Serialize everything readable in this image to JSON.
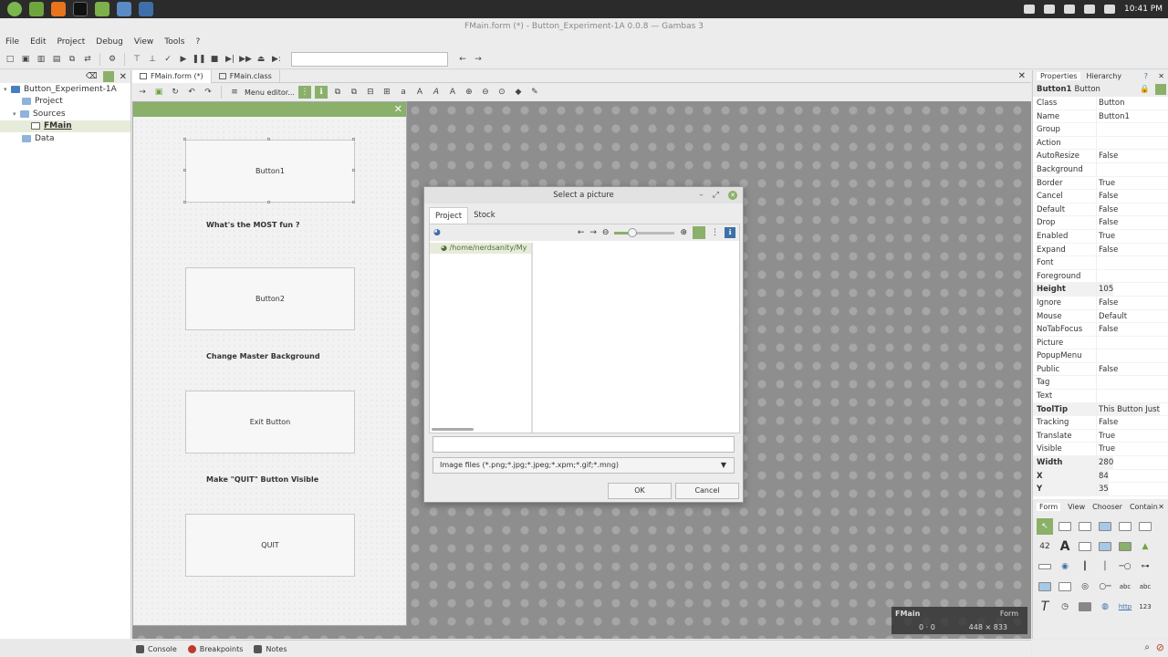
{
  "taskbar": {
    "time": "10:41 PM",
    "icons": [
      "mint-menu-icon",
      "files-icon",
      "firefox-icon",
      "terminal-icon",
      "folder-icon",
      "gambas-icon",
      "screenshot-icon"
    ]
  },
  "window": {
    "title": "FMain.form (*) - Button_Experiment-1A 0.0.8 — Gambas 3"
  },
  "menu": [
    "File",
    "Edit",
    "Project",
    "Debug",
    "View",
    "Tools",
    "?"
  ],
  "project_tree": {
    "root": "Button_Experiment-1A",
    "items": [
      {
        "label": "Project",
        "level": 1
      },
      {
        "label": "Sources",
        "level": 1
      },
      {
        "label": "FMain",
        "level": 2
      },
      {
        "label": "Data",
        "level": 1
      }
    ]
  },
  "editor_tabs": [
    "FMain.form (*)",
    "FMain.class"
  ],
  "editor_toolbar": {
    "menu_editor": "Menu editor..."
  },
  "form": {
    "buttons": [
      {
        "label": "Button1"
      },
      {
        "label": "Button2"
      },
      {
        "label": "Exit Button"
      },
      {
        "label": "QUIT"
      }
    ],
    "labels": [
      "What's the MOST fun ?",
      "Change Master Background",
      "Make \"QUIT\" Button Visible"
    ]
  },
  "dialog": {
    "title": "Select a picture",
    "tabs": [
      "Project",
      "Stock"
    ],
    "dir_path": "/home/nerdsanity/My",
    "zoom_fraction": 0.3,
    "filter": "Image files (*.png;*.jpg;*.jpeg;*.xpm;*.gif;*.mng)",
    "ok_label": "OK",
    "cancel_label": "Cancel"
  },
  "info_box": {
    "name": "FMain",
    "type": "Form",
    "pos": "0 · 0",
    "size": "448 × 833"
  },
  "properties": {
    "tabs": [
      "Properties",
      "Hierarchy"
    ],
    "title_name": "Button1",
    "title_type": "Button",
    "rows": [
      {
        "name": "Class",
        "value": "Button",
        "bold": false
      },
      {
        "name": "Name",
        "value": "Button1",
        "bold": false
      },
      {
        "name": "Group",
        "value": "",
        "bold": false
      },
      {
        "name": "Action",
        "value": "",
        "bold": false
      },
      {
        "name": "AutoResize",
        "value": "False",
        "bold": false
      },
      {
        "name": "Background",
        "value": "",
        "bold": false
      },
      {
        "name": "Border",
        "value": "True",
        "bold": false
      },
      {
        "name": "Cancel",
        "value": "False",
        "bold": false
      },
      {
        "name": "Default",
        "value": "False",
        "bold": false
      },
      {
        "name": "Drop",
        "value": "False",
        "bold": false
      },
      {
        "name": "Enabled",
        "value": "True",
        "bold": false
      },
      {
        "name": "Expand",
        "value": "False",
        "bold": false
      },
      {
        "name": "Font",
        "value": "",
        "bold": false
      },
      {
        "name": "Foreground",
        "value": "",
        "bold": false
      },
      {
        "name": "Height",
        "value": "105",
        "bold": true
      },
      {
        "name": "Ignore",
        "value": "False",
        "bold": false
      },
      {
        "name": "Mouse",
        "value": "Default",
        "bold": false
      },
      {
        "name": "NoTabFocus",
        "value": "False",
        "bold": false
      },
      {
        "name": "Picture",
        "value": "",
        "bold": false
      },
      {
        "name": "PopupMenu",
        "value": "",
        "bold": false
      },
      {
        "name": "Public",
        "value": "False",
        "bold": false
      },
      {
        "name": "Tag",
        "value": "",
        "bold": false
      },
      {
        "name": "Text",
        "value": "",
        "bold": false
      },
      {
        "name": "ToolTip",
        "value": "This Button Just",
        "bold": true
      },
      {
        "name": "Tracking",
        "value": "False",
        "bold": false
      },
      {
        "name": "Translate",
        "value": "True",
        "bold": false
      },
      {
        "name": "Visible",
        "value": "True",
        "bold": false
      },
      {
        "name": "Width",
        "value": "280",
        "bold": true
      },
      {
        "name": "X",
        "value": "84",
        "bold": true
      },
      {
        "name": "Y",
        "value": "35",
        "bold": true
      }
    ]
  },
  "toolbox": {
    "tabs": [
      "Form",
      "View",
      "Chooser",
      "Contain"
    ]
  },
  "statusbar": [
    "Console",
    "Breakpoints",
    "Notes"
  ],
  "colors": {
    "accent": "#8ab06a",
    "canvas": "#8e8e8e"
  }
}
